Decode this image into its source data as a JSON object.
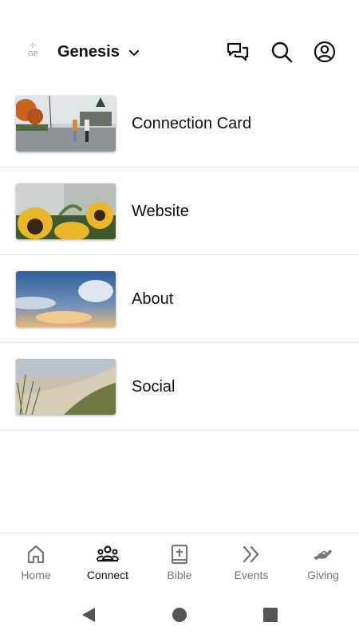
{
  "header": {
    "church_name": "Genesis",
    "logo_text": "GP",
    "icons": [
      "chat-icon",
      "search-icon",
      "account-icon"
    ]
  },
  "menu": {
    "items": [
      {
        "label": "Connection Card",
        "image": "couple-walking-autumn-street"
      },
      {
        "label": "Website",
        "image": "sunflowers"
      },
      {
        "label": "About",
        "image": "clouds-sunset-sky"
      },
      {
        "label": "Social",
        "image": "beach-dune-grass"
      }
    ]
  },
  "tabbar": {
    "tabs": [
      {
        "label": "Home",
        "icon": "home-icon",
        "active": false
      },
      {
        "label": "Connect",
        "icon": "people-group-icon",
        "active": true
      },
      {
        "label": "Bible",
        "icon": "bible-icon",
        "active": false
      },
      {
        "label": "Events",
        "icon": "double-chevron-icon",
        "active": false
      },
      {
        "label": "Giving",
        "icon": "hand-giving-icon",
        "active": false
      }
    ]
  },
  "system_nav": [
    "back-icon",
    "home-circle-icon",
    "recents-icon"
  ],
  "colors": {
    "background": "#ffffff",
    "text": "#111111",
    "inactive": "#777777",
    "divider": "#e6e6e6"
  }
}
